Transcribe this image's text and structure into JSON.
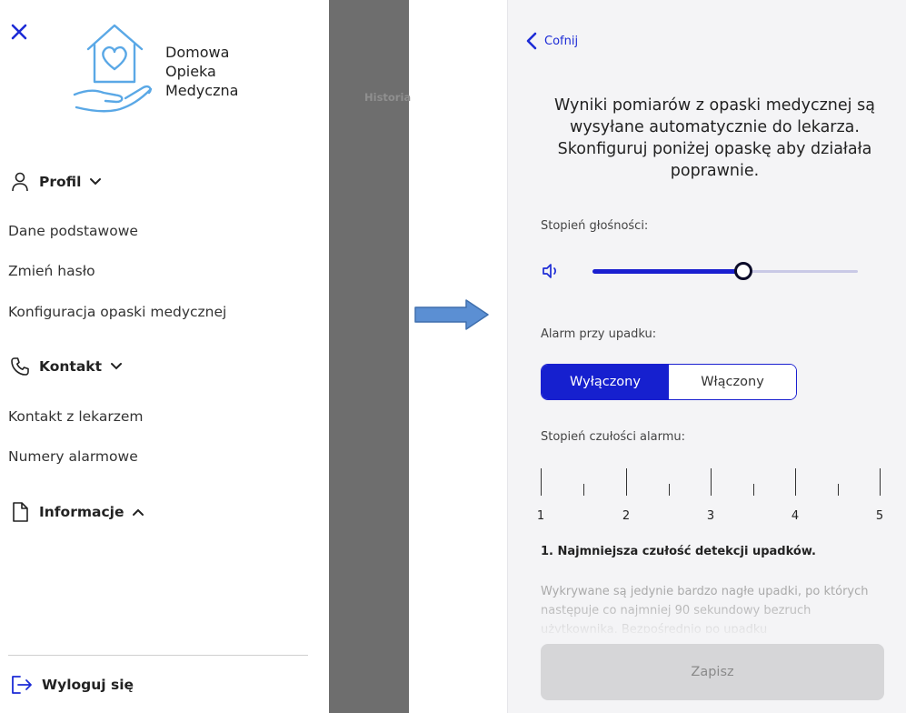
{
  "menu": {
    "logo_lines": [
      "Domowa",
      "Opieka",
      "Medyczna"
    ],
    "profile": {
      "heading": "Profil",
      "icon": "user-icon",
      "expanded": true,
      "items": [
        "Dane podstawowe",
        "Zmień hasło",
        "Konfiguracja opaski medycznej"
      ]
    },
    "contact": {
      "heading": "Kontakt",
      "icon": "phone-icon",
      "expanded": true,
      "items": [
        "Kontakt z lekarzem",
        "Numery alarmowe"
      ]
    },
    "info": {
      "heading": "Informacje",
      "icon": "document-icon",
      "expanded": false
    },
    "logout_label": "Wyloguj się"
  },
  "background_screen": {
    "partial_text": "Historia"
  },
  "config": {
    "back_label": "Cofnij",
    "intro": "Wyniki pomiarów z opaski medycznej są wysyłane automatycznie do lekarza. Skonfiguruj poniżej opaskę aby działała poprawnie.",
    "volume": {
      "label": "Stopień głośności:",
      "level_fraction": 0.57
    },
    "fall_alarm": {
      "label": "Alarm przy upadku:",
      "options": [
        "Wyłączony",
        "Włączony"
      ],
      "selected": "Wyłączony"
    },
    "sensitivity": {
      "label": "Stopień czułości alarmu:",
      "scale_labels": [
        "1",
        "2",
        "3",
        "4",
        "5"
      ],
      "selected_title": "1. Najmniejsza czułość detekcji upadków.",
      "description": "Wykrywane są jedynie bardzo nagłe upadki, po których następuje co najmniej 90 sekundowy bezruch użytkownika. Bezpośrednio po upadku"
    },
    "save_label": "Zapisz"
  },
  "colors": {
    "accent": "#1a1fd0",
    "logo": "#5aa8e6",
    "arrow": "#5b8fd3",
    "overlay": "#6e6e6e",
    "disabled_button": "#d6d6d8"
  }
}
